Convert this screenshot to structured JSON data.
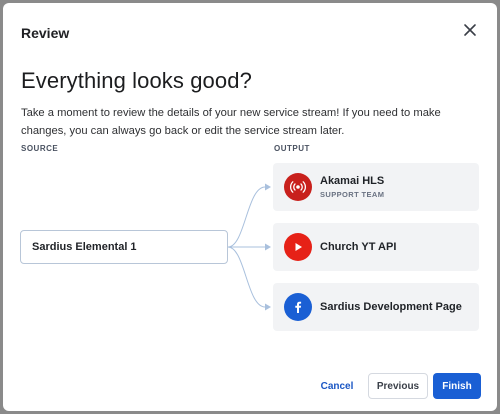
{
  "dialog": {
    "title": "Review",
    "heading": "Everything looks good?",
    "description": "Take a moment to review the details of your new service stream! If you need to make changes, you can always go back or edit the service stream later."
  },
  "columns": {
    "source_label": "SOURCE",
    "output_label": "OUTPUT"
  },
  "source": {
    "name": "Sardius Elemental 1"
  },
  "outputs": [
    {
      "name": "Akamai HLS",
      "subtitle": "SUPPORT TEAM",
      "icon": "broadcast-icon",
      "color": "#c8201c"
    },
    {
      "name": "Church YT API",
      "subtitle": "",
      "icon": "youtube-icon",
      "color": "#e62117"
    },
    {
      "name": "Sardius Development Page",
      "subtitle": "",
      "icon": "facebook-icon",
      "color": "#1a5fd4"
    }
  ],
  "buttons": {
    "cancel": "Cancel",
    "previous": "Previous",
    "finish": "Finish"
  },
  "colors": {
    "accent": "#1a5fd4",
    "connector": "#a9c0dd",
    "card_bg": "#f2f3f5"
  }
}
